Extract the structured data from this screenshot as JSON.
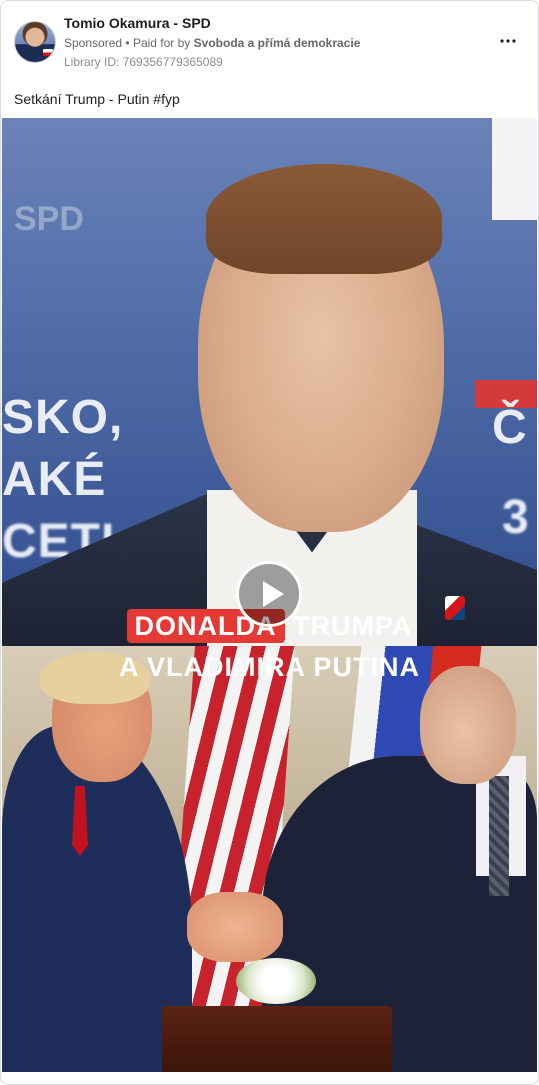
{
  "ad": {
    "page_name": "Tomio Okamura - SPD",
    "sponsored_label": "Sponsored",
    "bullet": "•",
    "paid_for_prefix": "Paid for by",
    "paid_for_by": "Svoboda a přímá demokracie",
    "library_id": "Library ID: 769356779365089",
    "caption": "Setkání Trump - Putin #fyp"
  },
  "video": {
    "overlay_highlight": "DONALDA",
    "overlay_line1_rest": " TRUMPA",
    "overlay_line2": "A VLADIMIRA PUTINA",
    "background_text_left": [
      "SKO,",
      "AKÉ",
      "CETI"
    ],
    "background_text_right": [
      "Č",
      "3"
    ],
    "background_logo": "SPD"
  },
  "icons": {
    "more": "more-horizontal-icon",
    "play": "play-icon"
  },
  "colors": {
    "highlight_red": "#e53935",
    "text_primary": "#1c1e21",
    "text_secondary": "#65676b"
  }
}
